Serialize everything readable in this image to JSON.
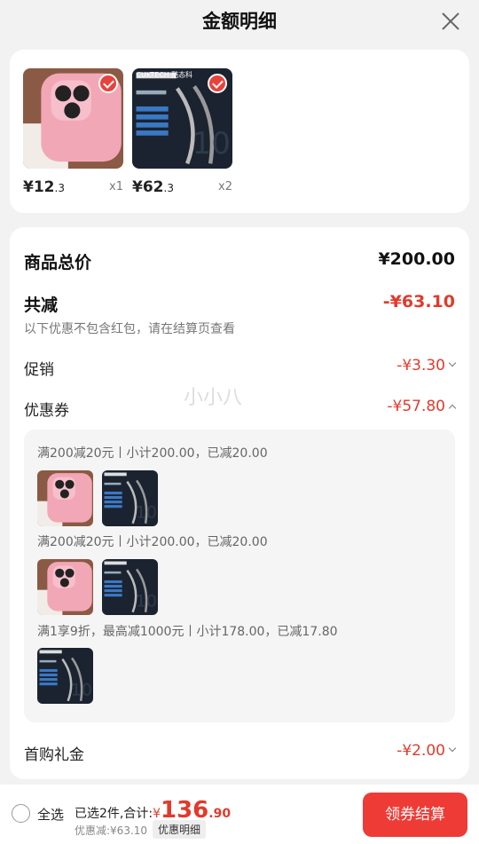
{
  "header": {
    "title": "金额明细"
  },
  "products": [
    {
      "price_int": "¥12",
      "price_dec": ".3",
      "qty": "x1"
    },
    {
      "price_int": "¥62",
      "price_dec": ".3",
      "qty": "x2"
    }
  ],
  "cable_brand": "CUKTECH 酷态科",
  "summary": {
    "total_label": "商品总价",
    "total_value": "¥200.00",
    "reduce_label": "共减",
    "reduce_value": "-¥63.10",
    "note": "以下优惠不包含红包，请在结算页查看",
    "promo_label": "促销",
    "promo_value": "-¥3.30",
    "coupon_label": "优惠券",
    "coupon_value": "-¥57.80",
    "first_label": "首购礼金",
    "first_value": "-¥2.00"
  },
  "coupons": [
    "满200减20元丨小计200.00，已减20.00",
    "满200减20元丨小计200.00，已减20.00",
    "满1享9折，最高减1000元丨小计178.00，已减17.80"
  ],
  "watermark": "小小八",
  "bottom": {
    "select_all": "全选",
    "selected_text": "已选2件,合计:",
    "yen": "¥",
    "total_int": "136",
    "total_dec": ".90",
    "discount_text": "优惠减:¥63.10",
    "discount_detail": "优惠明细",
    "pay_label": "领券结算"
  },
  "colors": {
    "accent": "#e23a2c",
    "button": "#ee3b36"
  }
}
